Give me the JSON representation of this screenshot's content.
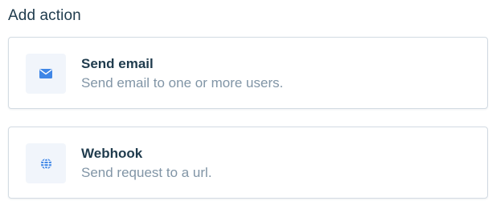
{
  "header": {
    "title": "Add action"
  },
  "actions": [
    {
      "title": "Send email",
      "description": "Send email to one or more users.",
      "icon": "envelope-icon"
    },
    {
      "title": "Webhook",
      "description": "Send request to a url.",
      "icon": "globe-icon"
    }
  ],
  "colors": {
    "title_text": "#1f3b4d",
    "description_text": "#8195a6",
    "icon_accent": "#3f86e6",
    "icon_bg": "#f1f5fb",
    "card_border": "#d3dbe3"
  }
}
